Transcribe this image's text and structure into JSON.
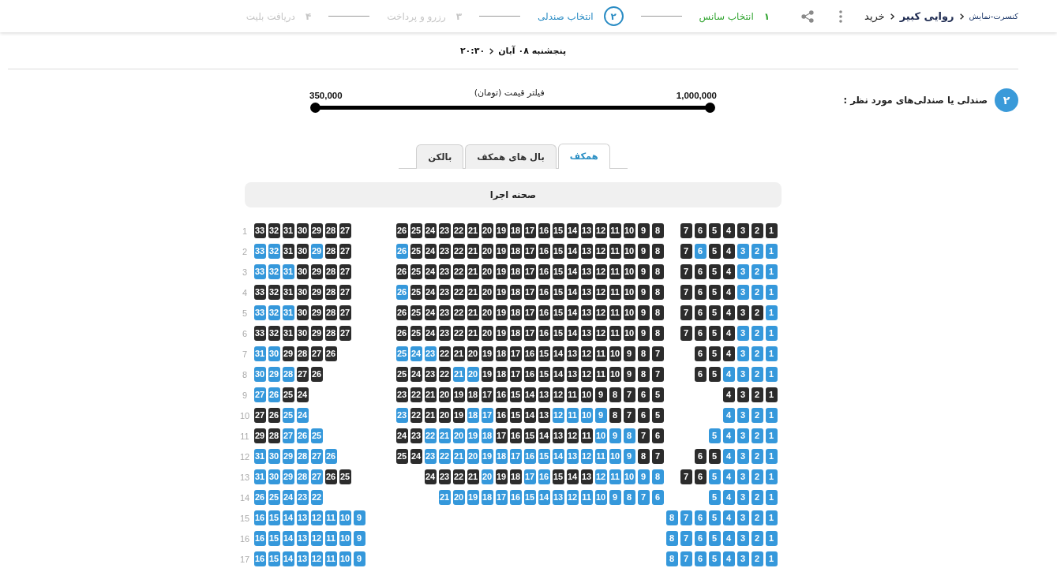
{
  "breadcrumb": [
    {
      "label": "کنسرت-نمایش",
      "kind": "category"
    },
    {
      "label": "روایی کبیر",
      "kind": "event"
    },
    {
      "label": "خرید",
      "kind": "page"
    }
  ],
  "steps": [
    {
      "number": "۱",
      "label": "انتخاب سانس",
      "completed": true,
      "current": false
    },
    {
      "number": "۲",
      "label": "انتخاب صندلی",
      "completed": false,
      "current": true
    },
    {
      "number": "۳",
      "label": "رزرو و پرداخت",
      "completed": false,
      "current": false
    },
    {
      "number": "۴",
      "label": "دریافت بلیت",
      "completed": false,
      "current": false
    }
  ],
  "show": {
    "date": "پنجشنبه ۰۸ آبان",
    "time": "۲۰:۳۰"
  },
  "section": {
    "number": "۲",
    "title": "صندلی یا صندلی‌های مورد نظر :"
  },
  "price_filter": {
    "title": "فیلتر قیمت (تومان)",
    "min_label": "350,000",
    "max_label": "1,000,000",
    "level": 1
  },
  "tabs": [
    {
      "label": "همکف",
      "selected": true
    },
    {
      "label": "بال های همکف",
      "selected": false
    },
    {
      "label": "بالکن",
      "selected": false
    }
  ],
  "stage": {
    "label": "صحنه اجرا"
  },
  "rows": [
    {
      "label": "1",
      "right": [
        {
          "number": "1",
          "sold": true
        },
        {
          "number": "2",
          "sold": true
        },
        {
          "number": "3",
          "sold": true
        },
        {
          "number": "4",
          "sold": true
        },
        {
          "number": "5",
          "sold": true
        },
        {
          "number": "6",
          "sold": true
        },
        {
          "number": "7",
          "sold": true
        }
      ],
      "center": [
        {
          "number": "8",
          "sold": true
        },
        {
          "number": "9",
          "sold": true
        },
        {
          "number": "10",
          "sold": true
        },
        {
          "number": "11",
          "sold": true
        },
        {
          "number": "12",
          "sold": true
        },
        {
          "number": "13",
          "sold": true
        },
        {
          "number": "14",
          "sold": true
        },
        {
          "number": "15",
          "sold": true
        },
        {
          "number": "16",
          "sold": true
        },
        {
          "number": "17",
          "sold": true
        },
        {
          "number": "18",
          "sold": true
        },
        {
          "number": "19",
          "sold": true
        },
        {
          "number": "20",
          "sold": true
        },
        {
          "number": "21",
          "sold": true
        },
        {
          "number": "22",
          "sold": true
        },
        {
          "number": "23",
          "sold": true
        },
        {
          "number": "24",
          "sold": true
        },
        {
          "number": "25",
          "sold": true
        },
        {
          "number": "26",
          "sold": true
        }
      ],
      "left": [
        {
          "number": "27",
          "sold": true
        },
        {
          "number": "28",
          "sold": true
        },
        {
          "number": "29",
          "sold": true
        },
        {
          "number": "30",
          "sold": true
        },
        {
          "number": "31",
          "sold": true
        },
        {
          "number": "32",
          "sold": true
        },
        {
          "number": "33",
          "sold": true
        }
      ]
    },
    {
      "label": "2",
      "right": [
        {
          "number": "1",
          "sold": false
        },
        {
          "number": "2",
          "sold": false
        },
        {
          "number": "3",
          "sold": false
        },
        {
          "number": "4",
          "sold": true
        },
        {
          "number": "5",
          "sold": true
        },
        {
          "number": "6",
          "sold": false
        },
        {
          "number": "7",
          "sold": true
        }
      ],
      "center": [
        {
          "number": "8",
          "sold": true
        },
        {
          "number": "9",
          "sold": true
        },
        {
          "number": "10",
          "sold": true
        },
        {
          "number": "11",
          "sold": true
        },
        {
          "number": "12",
          "sold": true
        },
        {
          "number": "13",
          "sold": true
        },
        {
          "number": "14",
          "sold": true
        },
        {
          "number": "15",
          "sold": true
        },
        {
          "number": "16",
          "sold": true
        },
        {
          "number": "17",
          "sold": true
        },
        {
          "number": "18",
          "sold": true
        },
        {
          "number": "19",
          "sold": true
        },
        {
          "number": "20",
          "sold": true
        },
        {
          "number": "21",
          "sold": true
        },
        {
          "number": "22",
          "sold": true
        },
        {
          "number": "23",
          "sold": true
        },
        {
          "number": "24",
          "sold": true
        },
        {
          "number": "25",
          "sold": true
        },
        {
          "number": "26",
          "sold": false
        }
      ],
      "left": [
        {
          "number": "27",
          "sold": true
        },
        {
          "number": "28",
          "sold": true
        },
        {
          "number": "29",
          "sold": false
        },
        {
          "number": "30",
          "sold": true
        },
        {
          "number": "31",
          "sold": true
        },
        {
          "number": "32",
          "sold": false
        },
        {
          "number": "33",
          "sold": false
        }
      ]
    },
    {
      "label": "3",
      "right": [
        {
          "number": "1",
          "sold": false
        },
        {
          "number": "2",
          "sold": false
        },
        {
          "number": "3",
          "sold": false
        },
        {
          "number": "4",
          "sold": true
        },
        {
          "number": "5",
          "sold": true
        },
        {
          "number": "6",
          "sold": true
        },
        {
          "number": "7",
          "sold": true
        }
      ],
      "center": [
        {
          "number": "8",
          "sold": true
        },
        {
          "number": "9",
          "sold": true
        },
        {
          "number": "10",
          "sold": true
        },
        {
          "number": "11",
          "sold": true
        },
        {
          "number": "12",
          "sold": true
        },
        {
          "number": "13",
          "sold": true
        },
        {
          "number": "14",
          "sold": true
        },
        {
          "number": "15",
          "sold": true
        },
        {
          "number": "16",
          "sold": true
        },
        {
          "number": "17",
          "sold": true
        },
        {
          "number": "18",
          "sold": true
        },
        {
          "number": "19",
          "sold": true
        },
        {
          "number": "20",
          "sold": true
        },
        {
          "number": "21",
          "sold": true
        },
        {
          "number": "22",
          "sold": true
        },
        {
          "number": "23",
          "sold": true
        },
        {
          "number": "24",
          "sold": true
        },
        {
          "number": "25",
          "sold": true
        },
        {
          "number": "26",
          "sold": true
        }
      ],
      "left": [
        {
          "number": "27",
          "sold": true
        },
        {
          "number": "28",
          "sold": true
        },
        {
          "number": "29",
          "sold": true
        },
        {
          "number": "30",
          "sold": true
        },
        {
          "number": "31",
          "sold": false
        },
        {
          "number": "32",
          "sold": false
        },
        {
          "number": "33",
          "sold": false
        }
      ]
    },
    {
      "label": "4",
      "right": [
        {
          "number": "1",
          "sold": false
        },
        {
          "number": "2",
          "sold": false
        },
        {
          "number": "3",
          "sold": false
        },
        {
          "number": "4",
          "sold": true
        },
        {
          "number": "5",
          "sold": true
        },
        {
          "number": "6",
          "sold": true
        },
        {
          "number": "7",
          "sold": true
        }
      ],
      "center": [
        {
          "number": "8",
          "sold": true
        },
        {
          "number": "9",
          "sold": true
        },
        {
          "number": "10",
          "sold": true
        },
        {
          "number": "11",
          "sold": true
        },
        {
          "number": "12",
          "sold": true
        },
        {
          "number": "13",
          "sold": true
        },
        {
          "number": "14",
          "sold": true
        },
        {
          "number": "15",
          "sold": true
        },
        {
          "number": "16",
          "sold": true
        },
        {
          "number": "17",
          "sold": true
        },
        {
          "number": "18",
          "sold": true
        },
        {
          "number": "19",
          "sold": true
        },
        {
          "number": "20",
          "sold": true
        },
        {
          "number": "21",
          "sold": true
        },
        {
          "number": "22",
          "sold": true
        },
        {
          "number": "23",
          "sold": true
        },
        {
          "number": "24",
          "sold": true
        },
        {
          "number": "25",
          "sold": true
        },
        {
          "number": "26",
          "sold": false
        }
      ],
      "left": [
        {
          "number": "27",
          "sold": true
        },
        {
          "number": "28",
          "sold": true
        },
        {
          "number": "29",
          "sold": true
        },
        {
          "number": "30",
          "sold": true
        },
        {
          "number": "31",
          "sold": true
        },
        {
          "number": "32",
          "sold": true
        },
        {
          "number": "33",
          "sold": true
        }
      ]
    },
    {
      "label": "5",
      "right": [
        {
          "number": "1",
          "sold": false
        },
        {
          "number": "2",
          "sold": true
        },
        {
          "number": "3",
          "sold": true
        },
        {
          "number": "4",
          "sold": true
        },
        {
          "number": "5",
          "sold": true
        },
        {
          "number": "6",
          "sold": true
        },
        {
          "number": "7",
          "sold": true
        }
      ],
      "center": [
        {
          "number": "8",
          "sold": true
        },
        {
          "number": "9",
          "sold": true
        },
        {
          "number": "10",
          "sold": true
        },
        {
          "number": "11",
          "sold": true
        },
        {
          "number": "12",
          "sold": true
        },
        {
          "number": "13",
          "sold": true
        },
        {
          "number": "14",
          "sold": true
        },
        {
          "number": "15",
          "sold": true
        },
        {
          "number": "16",
          "sold": true
        },
        {
          "number": "17",
          "sold": true
        },
        {
          "number": "18",
          "sold": true
        },
        {
          "number": "19",
          "sold": true
        },
        {
          "number": "20",
          "sold": true
        },
        {
          "number": "21",
          "sold": true
        },
        {
          "number": "22",
          "sold": true
        },
        {
          "number": "23",
          "sold": true
        },
        {
          "number": "24",
          "sold": true
        },
        {
          "number": "25",
          "sold": true
        },
        {
          "number": "26",
          "sold": true
        }
      ],
      "left": [
        {
          "number": "27",
          "sold": true
        },
        {
          "number": "28",
          "sold": true
        },
        {
          "number": "29",
          "sold": true
        },
        {
          "number": "30",
          "sold": true
        },
        {
          "number": "31",
          "sold": false
        },
        {
          "number": "32",
          "sold": false
        },
        {
          "number": "33",
          "sold": false
        }
      ]
    },
    {
      "label": "6",
      "right": [
        {
          "number": "1",
          "sold": false
        },
        {
          "number": "2",
          "sold": false
        },
        {
          "number": "3",
          "sold": false
        },
        {
          "number": "4",
          "sold": true
        },
        {
          "number": "5",
          "sold": true
        },
        {
          "number": "6",
          "sold": true
        },
        {
          "number": "7",
          "sold": true
        }
      ],
      "center": [
        {
          "number": "8",
          "sold": true
        },
        {
          "number": "9",
          "sold": true
        },
        {
          "number": "10",
          "sold": true
        },
        {
          "number": "11",
          "sold": true
        },
        {
          "number": "12",
          "sold": true
        },
        {
          "number": "13",
          "sold": true
        },
        {
          "number": "14",
          "sold": true
        },
        {
          "number": "15",
          "sold": true
        },
        {
          "number": "16",
          "sold": true
        },
        {
          "number": "17",
          "sold": true
        },
        {
          "number": "18",
          "sold": true
        },
        {
          "number": "19",
          "sold": true
        },
        {
          "number": "20",
          "sold": true
        },
        {
          "number": "21",
          "sold": true
        },
        {
          "number": "22",
          "sold": true
        },
        {
          "number": "23",
          "sold": true
        },
        {
          "number": "24",
          "sold": true
        },
        {
          "number": "25",
          "sold": true
        },
        {
          "number": "26",
          "sold": true
        }
      ],
      "left": [
        {
          "number": "27",
          "sold": true
        },
        {
          "number": "28",
          "sold": true
        },
        {
          "number": "29",
          "sold": true
        },
        {
          "number": "30",
          "sold": true
        },
        {
          "number": "31",
          "sold": true
        },
        {
          "number": "32",
          "sold": true
        },
        {
          "number": "33",
          "sold": true
        }
      ]
    },
    {
      "label": "7",
      "right": [
        {
          "number": "1",
          "sold": false
        },
        {
          "number": "2",
          "sold": false
        },
        {
          "number": "3",
          "sold": false
        },
        {
          "number": "4",
          "sold": true
        },
        {
          "number": "5",
          "sold": true
        },
        {
          "number": "6",
          "sold": true
        }
      ],
      "center": [
        {
          "number": "7",
          "sold": true
        },
        {
          "number": "8",
          "sold": true
        },
        {
          "number": "9",
          "sold": true
        },
        {
          "number": "10",
          "sold": true
        },
        {
          "number": "11",
          "sold": true
        },
        {
          "number": "12",
          "sold": true
        },
        {
          "number": "13",
          "sold": true
        },
        {
          "number": "14",
          "sold": true
        },
        {
          "number": "15",
          "sold": true
        },
        {
          "number": "16",
          "sold": true
        },
        {
          "number": "17",
          "sold": true
        },
        {
          "number": "18",
          "sold": true
        },
        {
          "number": "19",
          "sold": true
        },
        {
          "number": "20",
          "sold": true
        },
        {
          "number": "21",
          "sold": true
        },
        {
          "number": "22",
          "sold": true
        },
        {
          "number": "23",
          "sold": false
        },
        {
          "number": "24",
          "sold": false
        },
        {
          "number": "25",
          "sold": false
        }
      ],
      "left": [
        {
          "number": "26",
          "sold": true
        },
        {
          "number": "27",
          "sold": true
        },
        {
          "number": "28",
          "sold": true
        },
        {
          "number": "29",
          "sold": true
        },
        {
          "number": "30",
          "sold": false
        },
        {
          "number": "31",
          "sold": false
        }
      ]
    },
    {
      "label": "8",
      "right": [
        {
          "number": "1",
          "sold": false
        },
        {
          "number": "2",
          "sold": false
        },
        {
          "number": "3",
          "sold": false
        },
        {
          "number": "4",
          "sold": false
        },
        {
          "number": "5",
          "sold": true
        },
        {
          "number": "6",
          "sold": true
        }
      ],
      "center": [
        {
          "number": "7",
          "sold": true
        },
        {
          "number": "8",
          "sold": true
        },
        {
          "number": "9",
          "sold": true
        },
        {
          "number": "10",
          "sold": true
        },
        {
          "number": "11",
          "sold": true
        },
        {
          "number": "12",
          "sold": true
        },
        {
          "number": "13",
          "sold": true
        },
        {
          "number": "14",
          "sold": true
        },
        {
          "number": "15",
          "sold": true
        },
        {
          "number": "16",
          "sold": true
        },
        {
          "number": "17",
          "sold": true
        },
        {
          "number": "18",
          "sold": true
        },
        {
          "number": "19",
          "sold": true
        },
        {
          "number": "20",
          "sold": false
        },
        {
          "number": "21",
          "sold": false
        },
        {
          "number": "22",
          "sold": true
        },
        {
          "number": "23",
          "sold": true
        },
        {
          "number": "24",
          "sold": true
        },
        {
          "number": "25",
          "sold": true
        }
      ],
      "left": [
        {
          "number": "26",
          "sold": true
        },
        {
          "number": "27",
          "sold": true
        },
        {
          "number": "28",
          "sold": false
        },
        {
          "number": "29",
          "sold": false
        },
        {
          "number": "30",
          "sold": false
        }
      ]
    },
    {
      "label": "9",
      "right": [
        {
          "number": "1",
          "sold": true
        },
        {
          "number": "2",
          "sold": true
        },
        {
          "number": "3",
          "sold": true
        },
        {
          "number": "4",
          "sold": true
        }
      ],
      "center": [
        {
          "number": "5",
          "sold": true
        },
        {
          "number": "6",
          "sold": true
        },
        {
          "number": "7",
          "sold": true
        },
        {
          "number": "8",
          "sold": true
        },
        {
          "number": "9",
          "sold": true
        },
        {
          "number": "10",
          "sold": true
        },
        {
          "number": "11",
          "sold": true
        },
        {
          "number": "12",
          "sold": true
        },
        {
          "number": "13",
          "sold": true
        },
        {
          "number": "14",
          "sold": true
        },
        {
          "number": "15",
          "sold": true
        },
        {
          "number": "16",
          "sold": true
        },
        {
          "number": "17",
          "sold": true
        },
        {
          "number": "18",
          "sold": true
        },
        {
          "number": "19",
          "sold": true
        },
        {
          "number": "20",
          "sold": true
        },
        {
          "number": "21",
          "sold": true
        },
        {
          "number": "22",
          "sold": true
        },
        {
          "number": "23",
          "sold": true
        }
      ],
      "left": [
        {
          "number": "24",
          "sold": true
        },
        {
          "number": "25",
          "sold": true
        },
        {
          "number": "26",
          "sold": false
        },
        {
          "number": "27",
          "sold": false
        }
      ]
    },
    {
      "label": "10",
      "right": [
        {
          "number": "1",
          "sold": false
        },
        {
          "number": "2",
          "sold": false
        },
        {
          "number": "3",
          "sold": false
        },
        {
          "number": "4",
          "sold": false
        }
      ],
      "center": [
        {
          "number": "5",
          "sold": true
        },
        {
          "number": "6",
          "sold": true
        },
        {
          "number": "7",
          "sold": true
        },
        {
          "number": "8",
          "sold": true
        },
        {
          "number": "9",
          "sold": false
        },
        {
          "number": "10",
          "sold": false
        },
        {
          "number": "11",
          "sold": false
        },
        {
          "number": "12",
          "sold": false
        },
        {
          "number": "13",
          "sold": true
        },
        {
          "number": "14",
          "sold": true
        },
        {
          "number": "15",
          "sold": true
        },
        {
          "number": "16",
          "sold": true
        },
        {
          "number": "17",
          "sold": false
        },
        {
          "number": "18",
          "sold": false
        },
        {
          "number": "19",
          "sold": true
        },
        {
          "number": "20",
          "sold": true
        },
        {
          "number": "21",
          "sold": true
        },
        {
          "number": "22",
          "sold": true
        },
        {
          "number": "23",
          "sold": false
        }
      ],
      "left": [
        {
          "number": "24",
          "sold": false
        },
        {
          "number": "25",
          "sold": false
        },
        {
          "number": "26",
          "sold": true
        },
        {
          "number": "27",
          "sold": true
        }
      ]
    },
    {
      "label": "11",
      "right": [
        {
          "number": "1",
          "sold": false
        },
        {
          "number": "2",
          "sold": false
        },
        {
          "number": "3",
          "sold": false
        },
        {
          "number": "4",
          "sold": false
        },
        {
          "number": "5",
          "sold": false
        }
      ],
      "center": [
        {
          "number": "6",
          "sold": true
        },
        {
          "number": "7",
          "sold": true
        },
        {
          "number": "8",
          "sold": false
        },
        {
          "number": "9",
          "sold": false
        },
        {
          "number": "10",
          "sold": false
        },
        {
          "number": "11",
          "sold": true
        },
        {
          "number": "12",
          "sold": true
        },
        {
          "number": "13",
          "sold": true
        },
        {
          "number": "14",
          "sold": true
        },
        {
          "number": "15",
          "sold": true
        },
        {
          "number": "16",
          "sold": true
        },
        {
          "number": "17",
          "sold": true
        },
        {
          "number": "18",
          "sold": false
        },
        {
          "number": "19",
          "sold": false
        },
        {
          "number": "20",
          "sold": false
        },
        {
          "number": "21",
          "sold": false
        },
        {
          "number": "22",
          "sold": false
        },
        {
          "number": "23",
          "sold": true
        },
        {
          "number": "24",
          "sold": true
        }
      ],
      "left": [
        {
          "number": "25",
          "sold": false
        },
        {
          "number": "26",
          "sold": false
        },
        {
          "number": "27",
          "sold": false
        },
        {
          "number": "28",
          "sold": true
        },
        {
          "number": "29",
          "sold": true
        }
      ]
    },
    {
      "label": "12",
      "right": [
        {
          "number": "1",
          "sold": false
        },
        {
          "number": "2",
          "sold": false
        },
        {
          "number": "3",
          "sold": false
        },
        {
          "number": "4",
          "sold": false
        },
        {
          "number": "5",
          "sold": true
        },
        {
          "number": "6",
          "sold": true
        }
      ],
      "center": [
        {
          "number": "7",
          "sold": true
        },
        {
          "number": "8",
          "sold": true
        },
        {
          "number": "9",
          "sold": false
        },
        {
          "number": "10",
          "sold": false
        },
        {
          "number": "11",
          "sold": false
        },
        {
          "number": "12",
          "sold": false
        },
        {
          "number": "13",
          "sold": false
        },
        {
          "number": "14",
          "sold": false
        },
        {
          "number": "15",
          "sold": false
        },
        {
          "number": "16",
          "sold": false
        },
        {
          "number": "17",
          "sold": false
        },
        {
          "number": "18",
          "sold": false
        },
        {
          "number": "19",
          "sold": false
        },
        {
          "number": "20",
          "sold": false
        },
        {
          "number": "21",
          "sold": false
        },
        {
          "number": "22",
          "sold": false
        },
        {
          "number": "23",
          "sold": false
        },
        {
          "number": "24",
          "sold": true
        },
        {
          "number": "25",
          "sold": true
        }
      ],
      "left": [
        {
          "number": "26",
          "sold": false
        },
        {
          "number": "27",
          "sold": false
        },
        {
          "number": "28",
          "sold": false
        },
        {
          "number": "29",
          "sold": false
        },
        {
          "number": "30",
          "sold": false
        },
        {
          "number": "31",
          "sold": false
        }
      ]
    },
    {
      "label": "13",
      "right": [
        {
          "number": "1",
          "sold": false
        },
        {
          "number": "2",
          "sold": false
        },
        {
          "number": "3",
          "sold": false
        },
        {
          "number": "4",
          "sold": false
        },
        {
          "number": "5",
          "sold": false
        },
        {
          "number": "6",
          "sold": true
        },
        {
          "number": "7",
          "sold": true
        }
      ],
      "center": [
        {
          "number": "8",
          "sold": false
        },
        {
          "number": "9",
          "sold": false
        },
        {
          "number": "10",
          "sold": false
        },
        {
          "number": "11",
          "sold": false
        },
        {
          "number": "12",
          "sold": false
        },
        {
          "number": "13",
          "sold": true
        },
        {
          "number": "14",
          "sold": true
        },
        {
          "number": "15",
          "sold": true
        },
        {
          "number": "16",
          "sold": false
        },
        {
          "number": "17",
          "sold": false
        },
        {
          "number": "18",
          "sold": true
        },
        {
          "number": "19",
          "sold": true
        },
        {
          "number": "20",
          "sold": false
        },
        {
          "number": "21",
          "sold": true
        },
        {
          "number": "22",
          "sold": true
        },
        {
          "number": "23",
          "sold": true
        },
        {
          "number": "24",
          "sold": true
        }
      ],
      "left": [
        {
          "number": "25",
          "sold": true
        },
        {
          "number": "26",
          "sold": true
        },
        {
          "number": "27",
          "sold": false
        },
        {
          "number": "28",
          "sold": false
        },
        {
          "number": "29",
          "sold": false
        },
        {
          "number": "30",
          "sold": false
        },
        {
          "number": "31",
          "sold": false
        }
      ]
    },
    {
      "label": "14",
      "right": [
        {
          "number": "1",
          "sold": false
        },
        {
          "number": "2",
          "sold": false
        },
        {
          "number": "3",
          "sold": false
        },
        {
          "number": "4",
          "sold": false
        },
        {
          "number": "5",
          "sold": false
        }
      ],
      "center": [
        {
          "number": "6",
          "sold": false
        },
        {
          "number": "7",
          "sold": false
        },
        {
          "number": "8",
          "sold": false
        },
        {
          "number": "9",
          "sold": false
        },
        {
          "number": "10",
          "sold": false
        },
        {
          "number": "11",
          "sold": false
        },
        {
          "number": "12",
          "sold": false
        },
        {
          "number": "13",
          "sold": false
        },
        {
          "number": "14",
          "sold": false
        },
        {
          "number": "15",
          "sold": false
        },
        {
          "number": "16",
          "sold": false
        },
        {
          "number": "17",
          "sold": false
        },
        {
          "number": "18",
          "sold": false
        },
        {
          "number": "19",
          "sold": false
        },
        {
          "number": "20",
          "sold": false
        },
        {
          "number": "21",
          "sold": false
        }
      ],
      "left": [
        {
          "number": "22",
          "sold": false
        },
        {
          "number": "23",
          "sold": false
        },
        {
          "number": "24",
          "sold": false
        },
        {
          "number": "25",
          "sold": false
        },
        {
          "number": "26",
          "sold": false
        }
      ]
    },
    {
      "label": "15",
      "right": [
        {
          "number": "1",
          "sold": false
        },
        {
          "number": "2",
          "sold": false
        },
        {
          "number": "3",
          "sold": false
        },
        {
          "number": "4",
          "sold": false
        },
        {
          "number": "5",
          "sold": false
        },
        {
          "number": "6",
          "sold": false
        },
        {
          "number": "7",
          "sold": false
        },
        {
          "number": "8",
          "sold": false
        }
      ],
      "left": [
        {
          "number": "9",
          "sold": false
        },
        {
          "number": "10",
          "sold": false
        },
        {
          "number": "11",
          "sold": false
        },
        {
          "number": "12",
          "sold": false
        },
        {
          "number": "13",
          "sold": false
        },
        {
          "number": "14",
          "sold": false
        },
        {
          "number": "15",
          "sold": false
        },
        {
          "number": "16",
          "sold": false
        }
      ]
    },
    {
      "label": "16",
      "right": [
        {
          "number": "1",
          "sold": false
        },
        {
          "number": "2",
          "sold": false
        },
        {
          "number": "3",
          "sold": false
        },
        {
          "number": "4",
          "sold": false
        },
        {
          "number": "5",
          "sold": false
        },
        {
          "number": "6",
          "sold": false
        },
        {
          "number": "7",
          "sold": false
        },
        {
          "number": "8",
          "sold": false
        }
      ],
      "left": [
        {
          "number": "9",
          "sold": false
        },
        {
          "number": "10",
          "sold": false
        },
        {
          "number": "11",
          "sold": false
        },
        {
          "number": "12",
          "sold": false
        },
        {
          "number": "13",
          "sold": false
        },
        {
          "number": "14",
          "sold": false
        },
        {
          "number": "15",
          "sold": false
        },
        {
          "number": "16",
          "sold": false
        }
      ]
    },
    {
      "label": "17",
      "right": [
        {
          "number": "1",
          "sold": false
        },
        {
          "number": "2",
          "sold": false
        },
        {
          "number": "3",
          "sold": false
        },
        {
          "number": "4",
          "sold": false
        },
        {
          "number": "5",
          "sold": false
        },
        {
          "number": "6",
          "sold": false
        },
        {
          "number": "7",
          "sold": false
        },
        {
          "number": "8",
          "sold": false
        }
      ],
      "left": [
        {
          "number": "9",
          "sold": false
        },
        {
          "number": "10",
          "sold": false
        },
        {
          "number": "11",
          "sold": false
        },
        {
          "number": "12",
          "sold": false
        },
        {
          "number": "13",
          "sold": false
        },
        {
          "number": "14",
          "sold": false
        },
        {
          "number": "15",
          "sold": false
        },
        {
          "number": "16",
          "sold": false
        }
      ]
    }
  ]
}
